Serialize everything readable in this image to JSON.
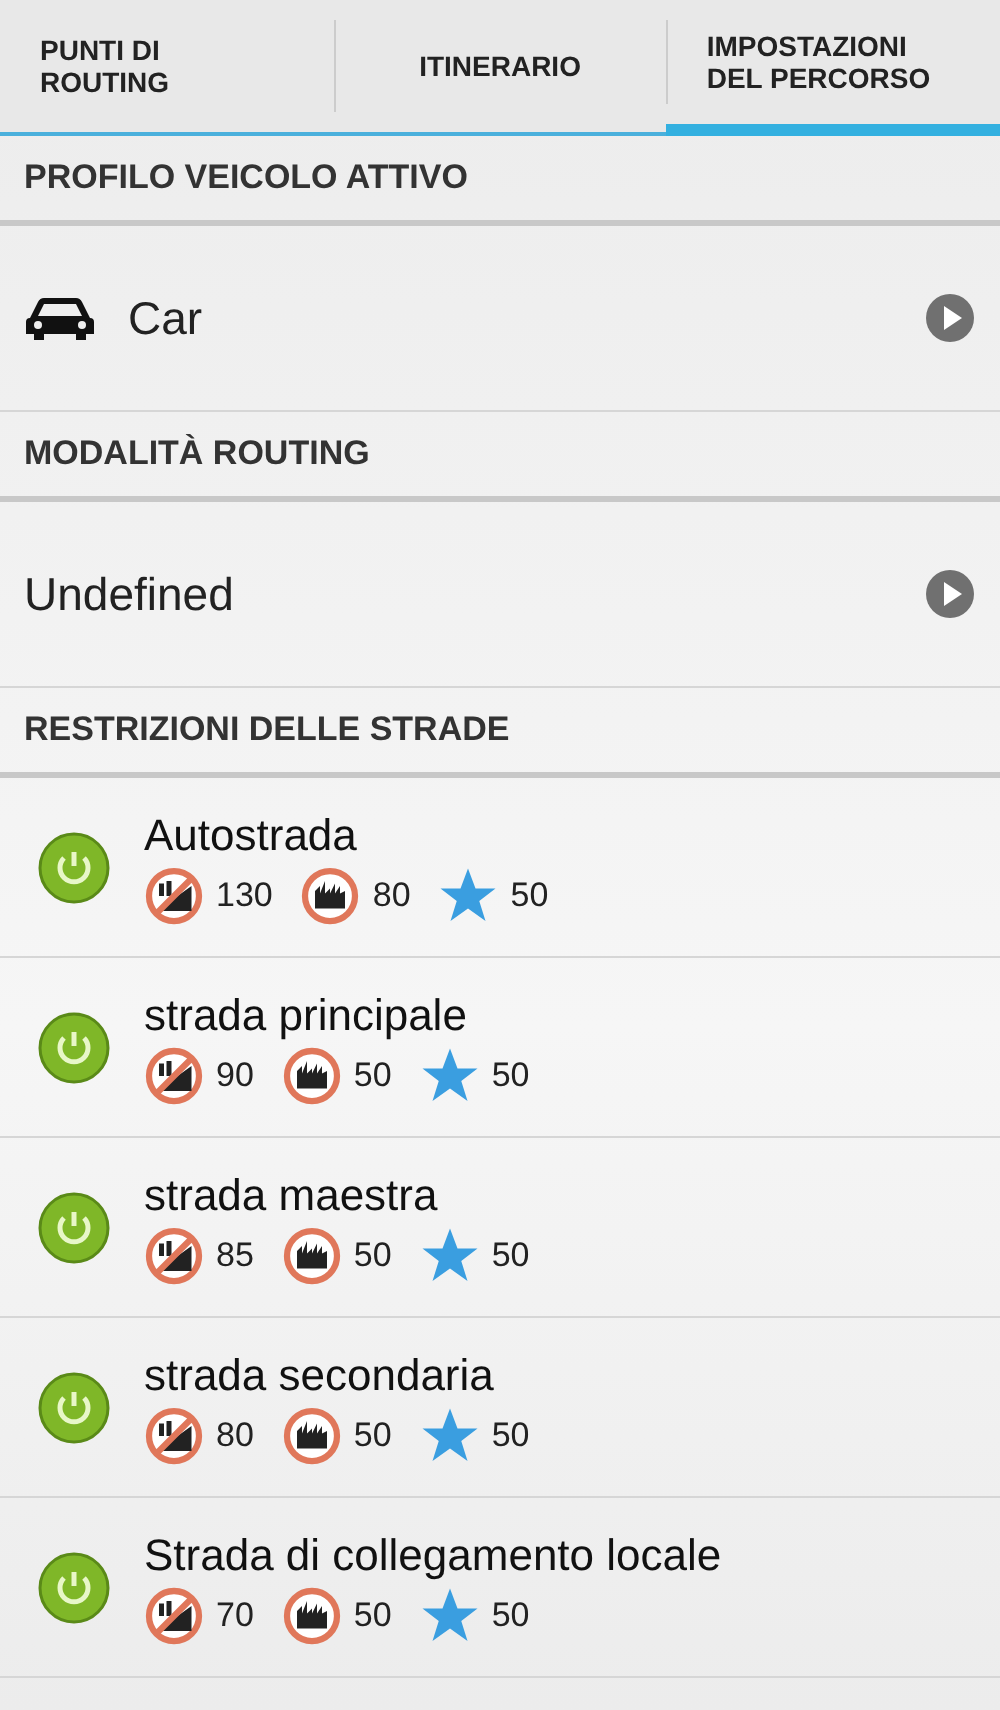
{
  "tabs": [
    {
      "label": "PUNTI DI ROUTING",
      "selected": false
    },
    {
      "label": "ITINERARIO",
      "selected": false
    },
    {
      "label": "IMPOSTAZIONI DEL PERCORSO",
      "selected": true
    }
  ],
  "sections": [
    {
      "title": "PROFILO VEICOLO ATTIVO",
      "kind": "vehicle",
      "value": "Car"
    },
    {
      "title": "MODALITÀ ROUTING",
      "kind": "choice",
      "value": "Undefined"
    },
    {
      "title": "RESTRIZIONI DELLE STRADE",
      "kind": "roads",
      "roads": [
        {
          "name": "Autostrada",
          "on": true,
          "values": [
            "130",
            "80",
            "50"
          ]
        },
        {
          "name": "strada principale",
          "on": true,
          "values": [
            "90",
            "50",
            "50"
          ]
        },
        {
          "name": "strada maestra",
          "on": true,
          "values": [
            "85",
            "50",
            "50"
          ]
        },
        {
          "name": "strada secondaria",
          "on": true,
          "values": [
            "80",
            "50",
            "50"
          ]
        },
        {
          "name": "Strada di collegamento locale",
          "on": true,
          "values": [
            "70",
            "50",
            "50"
          ]
        }
      ]
    }
  ]
}
